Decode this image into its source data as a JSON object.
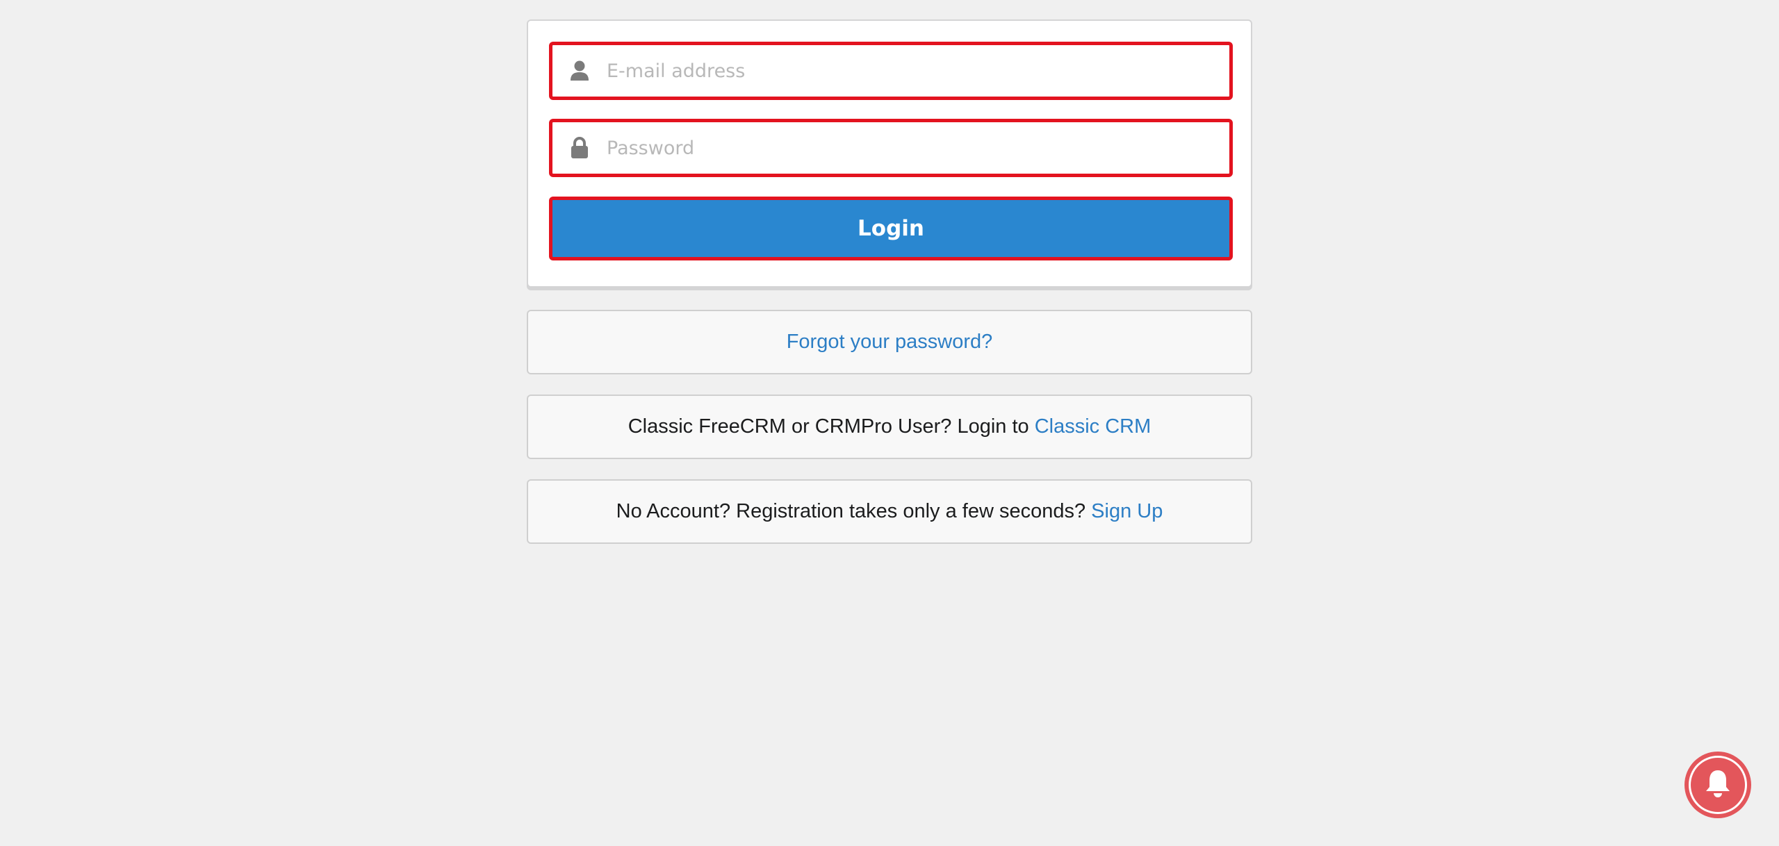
{
  "login_form": {
    "email": {
      "placeholder": "E-mail address",
      "value": "",
      "icon": "user-icon"
    },
    "password": {
      "placeholder": "Password",
      "value": "",
      "icon": "lock-icon"
    },
    "login_label": "Login"
  },
  "forgot": {
    "link_text": "Forgot your password?"
  },
  "classic": {
    "text": "Classic FreeCRM or CRMPro User? Login to",
    "link_text": "Classic CRM"
  },
  "signup": {
    "text": "No Account? Registration takes only a few seconds?",
    "link_text": "Sign Up"
  },
  "notification": {
    "icon": "bell-icon"
  },
  "colors": {
    "background": "#f0f0f0",
    "primary_button": "#2a87d0",
    "highlight_border": "#e3131f",
    "link": "#2c7ec5",
    "bell_button": "#e3565b"
  }
}
